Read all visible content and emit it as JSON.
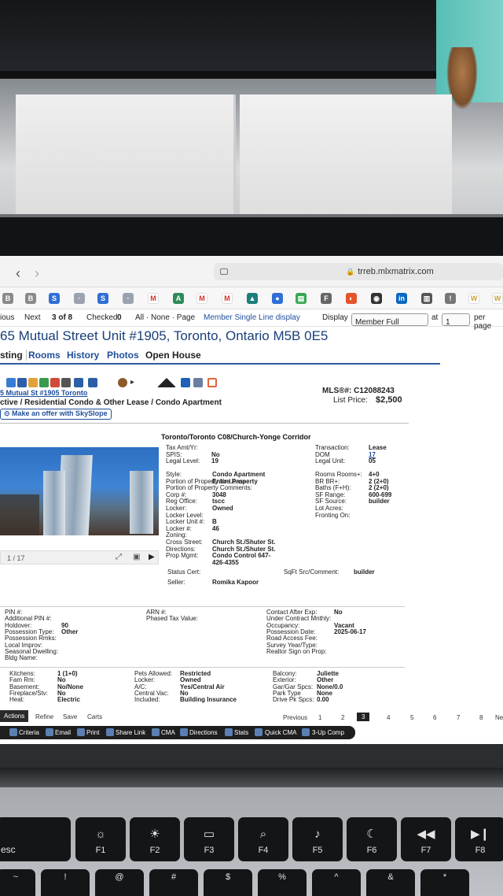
{
  "browser": {
    "url": "trreb.mlxmatrix.com"
  },
  "pager": {
    "previous": "ious",
    "next": "Next",
    "position": "3 of 8",
    "checked_label": "Checked",
    "checked_count": "0",
    "select_links": "All · None · Page",
    "member_link": "Member Single Line display",
    "display_label": "Display",
    "display_value": "Member Full",
    "at_label": "at",
    "per_page_value": "1",
    "per_page_label": "per page"
  },
  "listing": {
    "address": "65 Mutual Street Unit #1905, Toronto, Ontario M5B 0E5",
    "tabs": [
      "sting",
      "Rooms",
      "History",
      "Photos",
      "Open House"
    ],
    "short_address": "5 Mutual St #1905 Toronto",
    "status_line": "ctive / Residential Condo & Other Lease / Condo Apartment",
    "skyslope": "Make an offer with SkySlope",
    "mls_label": "MLS®#:",
    "mls_number": "C12088243",
    "price_label": "List Price:",
    "price": "$2,500",
    "area": "Toronto/Toronto C08/Church-Yonge Corridor",
    "photo_counter": "1 / 17"
  },
  "details_top": {
    "left": [
      {
        "label": "Tax Amt/Yr:",
        "value": ""
      },
      {
        "label": "SPIS:",
        "value": "No"
      },
      {
        "label": "Legal Level:",
        "value": "19"
      }
    ],
    "right": [
      {
        "label": "Transaction:",
        "value": "Lease"
      },
      {
        "label": "DOM",
        "value": "17"
      },
      {
        "label": "Legal Unit:",
        "value": "05"
      }
    ]
  },
  "details_mid": {
    "left": [
      {
        "label": "Style:",
        "value": "Condo Apartment"
      },
      {
        "label": "Portion of Property for Lease:",
        "value": "Entire Property"
      },
      {
        "label": "Portion of Property Comments:",
        "value": ""
      },
      {
        "label": "Corp #:",
        "value": "3048"
      },
      {
        "label": "Reg Office:",
        "value": "tscc"
      },
      {
        "label": "Locker:",
        "value": "Owned"
      },
      {
        "label": "Locker Level:",
        "value": ""
      },
      {
        "label": "Locker Unit #:",
        "value": "B"
      },
      {
        "label": "Locker #:",
        "value": "46"
      },
      {
        "label": "Zoning:",
        "value": ""
      },
      {
        "label": "Cross Street:",
        "value": "Church St./Shuter St."
      },
      {
        "label": "Directions:",
        "value": "Church St./Shuter St."
      },
      {
        "label": "Prop Mgmt:",
        "value": "Condo Control 647-"
      },
      {
        "label": "",
        "value": "426-4355"
      }
    ],
    "right": [
      {
        "label": "Rooms Rooms+:",
        "value": "4+0"
      },
      {
        "label": "BR BR+:",
        "value": "2 (2+0)"
      },
      {
        "label": "Baths (F+H):",
        "value": "2 (2+0)"
      },
      {
        "label": "SF Range:",
        "value": "600-699"
      },
      {
        "label": "SF Source:",
        "value": "builder"
      },
      {
        "label": "Lot Acres:",
        "value": ""
      },
      {
        "label": "Fronting On:",
        "value": ""
      }
    ],
    "status_cert": "Status Cert:",
    "sqft_label": "SqFt Src/Comment:",
    "sqft_value": "builder",
    "seller_label": "Seller:",
    "seller_value": "Romika Kapoor"
  },
  "details_lower": {
    "col1": [
      {
        "label": "PIN #:",
        "value": ""
      },
      {
        "label": "Additional PIN #:",
        "value": ""
      },
      {
        "label": "Holdover:",
        "value": "90"
      },
      {
        "label": "Possession Type:",
        "value": "Other"
      },
      {
        "label": "Possession Rmks:",
        "value": ""
      },
      {
        "label": "Local Improv:",
        "value": ""
      },
      {
        "label": "Seasonal Dwelling:",
        "value": ""
      },
      {
        "label": "Bldg Name:",
        "value": ""
      }
    ],
    "col2": [
      {
        "label": "ARN #:",
        "value": ""
      },
      {
        "label": "Phased Tax Value:",
        "value": ""
      }
    ],
    "col3": [
      {
        "label": "Contact After Exp:",
        "value": "No"
      },
      {
        "label": "Under Contract Mnthly:",
        "value": ""
      },
      {
        "label": "Occupancy:",
        "value": "Vacant"
      },
      {
        "label": "Possession Date:",
        "value": "2025-06-17"
      },
      {
        "label": "Road Access Fee:",
        "value": ""
      },
      {
        "label": "Survey Year/Type:",
        "value": ""
      },
      {
        "label": "Realtor Sign on Prop:",
        "value": ""
      }
    ]
  },
  "details_bottom": {
    "col1": [
      {
        "label": "Kitchens:",
        "value": "1 (1+0)"
      },
      {
        "label": "Fam Rm:",
        "value": "No"
      },
      {
        "label": "Basement:",
        "value": "No/None"
      },
      {
        "label": "Fireplace/Stv:",
        "value": "No"
      },
      {
        "label": "Heat:",
        "value": "Electric"
      }
    ],
    "col2": [
      {
        "label": "Pets Allowed:",
        "value": "Restricted"
      },
      {
        "label": "Locker:",
        "value": "Owned"
      },
      {
        "label": "A/C:",
        "value": "Yes/Central Air"
      },
      {
        "label": "Central Vac:",
        "value": "No"
      },
      {
        "label": "Included:",
        "value": "Building Insurance"
      }
    ],
    "col3": [
      {
        "label": "Balcony:",
        "value": "Juliette"
      },
      {
        "label": "Exterior:",
        "value": "Other"
      },
      {
        "label": "Gar/Gar Spcs:",
        "value": "None/0.0"
      },
      {
        "label": "Park Type",
        "value": "None"
      },
      {
        "label": "Drive Pk Spcs:",
        "value": "0.00"
      }
    ]
  },
  "pagination": {
    "previous": "Previous",
    "pages": [
      "1",
      "2",
      "3",
      "4",
      "5",
      "6",
      "7",
      "8"
    ],
    "current": "3",
    "next": "Ne"
  },
  "subtabs": [
    "Actions",
    "Refine",
    "Save",
    "Carts"
  ],
  "actions": [
    "Criteria",
    "Email",
    "Print",
    "Share Link",
    "CMA",
    "Directions",
    "Stats",
    "Quick CMA",
    "3-Up Comp"
  ],
  "keyboard": {
    "keys": [
      "esc",
      "F1",
      "F2",
      "F3",
      "F4",
      "F5",
      "F6",
      "F7",
      "F8"
    ],
    "row2": [
      "~",
      "!",
      "@",
      "#",
      "$",
      "%",
      "^",
      "&",
      "*"
    ]
  },
  "colors": {
    "link_blue": "#1f4e9b",
    "action_bar": "#1e1e1e"
  }
}
